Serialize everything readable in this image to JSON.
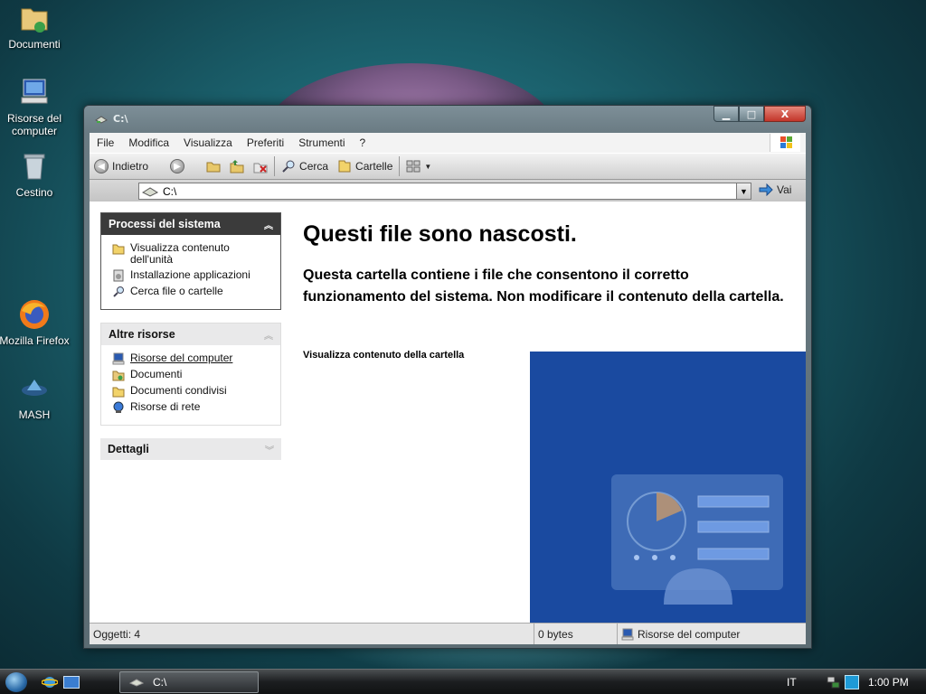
{
  "desktop": {
    "icons": [
      {
        "label": "Documenti",
        "icon": "documents-folder-icon"
      },
      {
        "label": "Risorse del computer",
        "icon": "my-computer-icon"
      },
      {
        "label": "Cestino",
        "icon": "recycle-bin-icon"
      },
      {
        "label": "Mozilla Firefox",
        "icon": "firefox-icon"
      },
      {
        "label": "MASH",
        "icon": "mash-icon"
      }
    ]
  },
  "window": {
    "title": "C:\\",
    "controls": {
      "minimize": "▁",
      "maximize": "□",
      "close": "X"
    }
  },
  "menu": [
    "File",
    "Modifica",
    "Visualizza",
    "Preferiti",
    "Strumenti",
    "?"
  ],
  "toolbar": {
    "back_label": "Indietro",
    "search_label": "Cerca",
    "folders_label": "Cartelle"
  },
  "address": {
    "value": "C:\\",
    "go_label": "Vai"
  },
  "taskpane": {
    "system_tasks": {
      "title": "Processi del sistema",
      "items": [
        {
          "label": "Visualizza contenuto dell'unità",
          "icon": "folder-view-icon"
        },
        {
          "label": "Installazione applicazioni",
          "icon": "install-apps-icon"
        },
        {
          "label": "Cerca file o cartelle",
          "icon": "search-icon"
        }
      ]
    },
    "other_places": {
      "title": "Altre risorse",
      "items": [
        {
          "label": "Risorse del computer",
          "icon": "my-computer-icon"
        },
        {
          "label": "Documenti",
          "icon": "documents-icon"
        },
        {
          "label": "Documenti condivisi",
          "icon": "shared-documents-icon"
        },
        {
          "label": "Risorse di rete",
          "icon": "network-icon"
        }
      ]
    },
    "details": {
      "title": "Dettagli"
    }
  },
  "main": {
    "heading": "Questi file sono nascosti.",
    "description": "Questa cartella contiene i file che consentono il corretto funzionamento del sistema. Non modificare il contenuto della cartella.",
    "show_link": "Visualizza contenuto della cartella"
  },
  "statusbar": {
    "objects": "Oggetti: 4",
    "size": "0 bytes",
    "location": "Risorse del computer"
  },
  "taskbar": {
    "task_label": "C:\\",
    "language": "IT",
    "clock": "1:00 PM"
  },
  "colors": {
    "blue_panel": "#1a4aa0",
    "close_button": "#c2352a",
    "taskpane_header_dark": "#3b3b3b"
  }
}
